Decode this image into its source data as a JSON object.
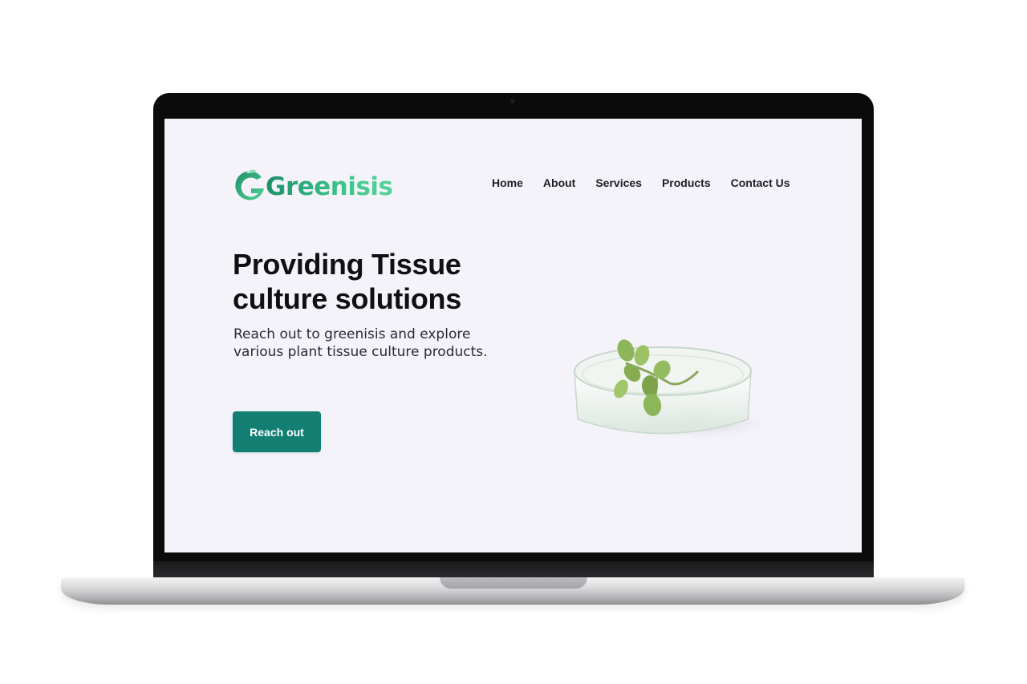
{
  "site": {
    "brand": "Greenisis",
    "nav": [
      "Home",
      "About",
      "Services",
      "Products",
      "Contact Us"
    ],
    "hero": {
      "title": "Providing Tissue culture solutions",
      "subtitle": "Reach out to greenisis and explore various plant tissue culture products.",
      "cta_label": "Reach out"
    }
  },
  "colors": {
    "screen_bg": "#f4f3f9",
    "accent": "#127f72",
    "brand_green": "#3cc48a",
    "text_dark": "#0f1014"
  },
  "icons": {
    "logo_mark": "g-leaf-logo-icon",
    "hero_image": "petri-dish-plant-icon"
  }
}
